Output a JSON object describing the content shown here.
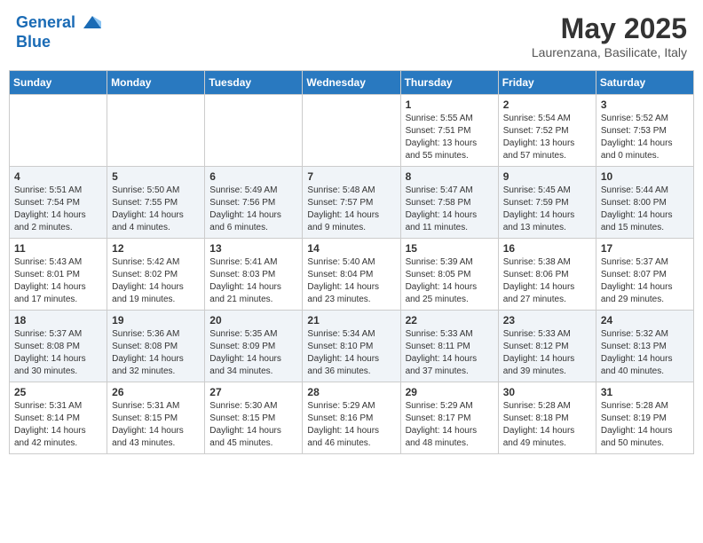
{
  "header": {
    "logo_line1": "General",
    "logo_line2": "Blue",
    "month": "May 2025",
    "location": "Laurenzana, Basilicate, Italy"
  },
  "weekdays": [
    "Sunday",
    "Monday",
    "Tuesday",
    "Wednesday",
    "Thursday",
    "Friday",
    "Saturday"
  ],
  "weeks": [
    [
      null,
      null,
      null,
      null,
      {
        "day": "1",
        "sunrise": "5:55 AM",
        "sunset": "7:51 PM",
        "daylight": "13 hours and 55 minutes."
      },
      {
        "day": "2",
        "sunrise": "5:54 AM",
        "sunset": "7:52 PM",
        "daylight": "13 hours and 57 minutes."
      },
      {
        "day": "3",
        "sunrise": "5:52 AM",
        "sunset": "7:53 PM",
        "daylight": "14 hours and 0 minutes."
      }
    ],
    [
      {
        "day": "4",
        "sunrise": "5:51 AM",
        "sunset": "7:54 PM",
        "daylight": "14 hours and 2 minutes."
      },
      {
        "day": "5",
        "sunrise": "5:50 AM",
        "sunset": "7:55 PM",
        "daylight": "14 hours and 4 minutes."
      },
      {
        "day": "6",
        "sunrise": "5:49 AM",
        "sunset": "7:56 PM",
        "daylight": "14 hours and 6 minutes."
      },
      {
        "day": "7",
        "sunrise": "5:48 AM",
        "sunset": "7:57 PM",
        "daylight": "14 hours and 9 minutes."
      },
      {
        "day": "8",
        "sunrise": "5:47 AM",
        "sunset": "7:58 PM",
        "daylight": "14 hours and 11 minutes."
      },
      {
        "day": "9",
        "sunrise": "5:45 AM",
        "sunset": "7:59 PM",
        "daylight": "14 hours and 13 minutes."
      },
      {
        "day": "10",
        "sunrise": "5:44 AM",
        "sunset": "8:00 PM",
        "daylight": "14 hours and 15 minutes."
      }
    ],
    [
      {
        "day": "11",
        "sunrise": "5:43 AM",
        "sunset": "8:01 PM",
        "daylight": "14 hours and 17 minutes."
      },
      {
        "day": "12",
        "sunrise": "5:42 AM",
        "sunset": "8:02 PM",
        "daylight": "14 hours and 19 minutes."
      },
      {
        "day": "13",
        "sunrise": "5:41 AM",
        "sunset": "8:03 PM",
        "daylight": "14 hours and 21 minutes."
      },
      {
        "day": "14",
        "sunrise": "5:40 AM",
        "sunset": "8:04 PM",
        "daylight": "14 hours and 23 minutes."
      },
      {
        "day": "15",
        "sunrise": "5:39 AM",
        "sunset": "8:05 PM",
        "daylight": "14 hours and 25 minutes."
      },
      {
        "day": "16",
        "sunrise": "5:38 AM",
        "sunset": "8:06 PM",
        "daylight": "14 hours and 27 minutes."
      },
      {
        "day": "17",
        "sunrise": "5:37 AM",
        "sunset": "8:07 PM",
        "daylight": "14 hours and 29 minutes."
      }
    ],
    [
      {
        "day": "18",
        "sunrise": "5:37 AM",
        "sunset": "8:08 PM",
        "daylight": "14 hours and 30 minutes."
      },
      {
        "day": "19",
        "sunrise": "5:36 AM",
        "sunset": "8:08 PM",
        "daylight": "14 hours and 32 minutes."
      },
      {
        "day": "20",
        "sunrise": "5:35 AM",
        "sunset": "8:09 PM",
        "daylight": "14 hours and 34 minutes."
      },
      {
        "day": "21",
        "sunrise": "5:34 AM",
        "sunset": "8:10 PM",
        "daylight": "14 hours and 36 minutes."
      },
      {
        "day": "22",
        "sunrise": "5:33 AM",
        "sunset": "8:11 PM",
        "daylight": "14 hours and 37 minutes."
      },
      {
        "day": "23",
        "sunrise": "5:33 AM",
        "sunset": "8:12 PM",
        "daylight": "14 hours and 39 minutes."
      },
      {
        "day": "24",
        "sunrise": "5:32 AM",
        "sunset": "8:13 PM",
        "daylight": "14 hours and 40 minutes."
      }
    ],
    [
      {
        "day": "25",
        "sunrise": "5:31 AM",
        "sunset": "8:14 PM",
        "daylight": "14 hours and 42 minutes."
      },
      {
        "day": "26",
        "sunrise": "5:31 AM",
        "sunset": "8:15 PM",
        "daylight": "14 hours and 43 minutes."
      },
      {
        "day": "27",
        "sunrise": "5:30 AM",
        "sunset": "8:15 PM",
        "daylight": "14 hours and 45 minutes."
      },
      {
        "day": "28",
        "sunrise": "5:29 AM",
        "sunset": "8:16 PM",
        "daylight": "14 hours and 46 minutes."
      },
      {
        "day": "29",
        "sunrise": "5:29 AM",
        "sunset": "8:17 PM",
        "daylight": "14 hours and 48 minutes."
      },
      {
        "day": "30",
        "sunrise": "5:28 AM",
        "sunset": "8:18 PM",
        "daylight": "14 hours and 49 minutes."
      },
      {
        "day": "31",
        "sunrise": "5:28 AM",
        "sunset": "8:19 PM",
        "daylight": "14 hours and 50 minutes."
      }
    ]
  ]
}
